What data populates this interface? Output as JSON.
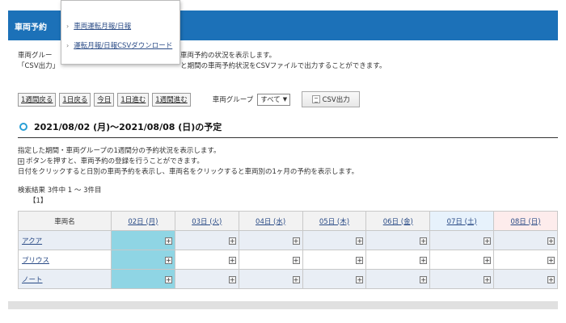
{
  "header": {
    "title": "車両予約"
  },
  "menu": {
    "items": [
      {
        "label": "車両運転月報/日報"
      },
      {
        "label": "運転月報/日報CSVダウンロード"
      }
    ]
  },
  "description": {
    "line1_prefix": "車両グルー",
    "line1_suffix": "の車両予約の状況を表示します。",
    "line2_prefix": "「CSV出力」",
    "line2_suffix": "と期間の車両予約状況をCSVファイルで出力することができます。"
  },
  "toolbar": {
    "buttons": [
      "1週間戻る",
      "1日戻る",
      "今日",
      "1日進む",
      "1週間進む"
    ],
    "group_label": "車両グループ",
    "group_value": "すべて",
    "csv_label": "CSV出力"
  },
  "period": {
    "title": "2021/08/02 (月)〜2021/08/08 (日)の予定"
  },
  "info": {
    "line1": "指定した期間・車両グループの1週間分の予約状況を表示します。",
    "line2": "ボタンを押すと、車両予約の登録を行うことができます。",
    "line3": "日付をクリックすると日別の車両予約を表示し、車両名をクリックすると車両別の1ヶ月の予約を表示します。"
  },
  "results": {
    "text": "検索結果  3件中    1 〜  3件目",
    "page": "【1】"
  },
  "table": {
    "name_header": "車両名",
    "days": [
      "02日 (月)",
      "03日 (火)",
      "04日 (水)",
      "05日 (木)",
      "06日 (金)",
      "07日 (土)",
      "08日 (日)"
    ],
    "vehicles": [
      "アクア",
      "プリウス",
      "ノート"
    ],
    "cell_symbol": "+"
  }
}
